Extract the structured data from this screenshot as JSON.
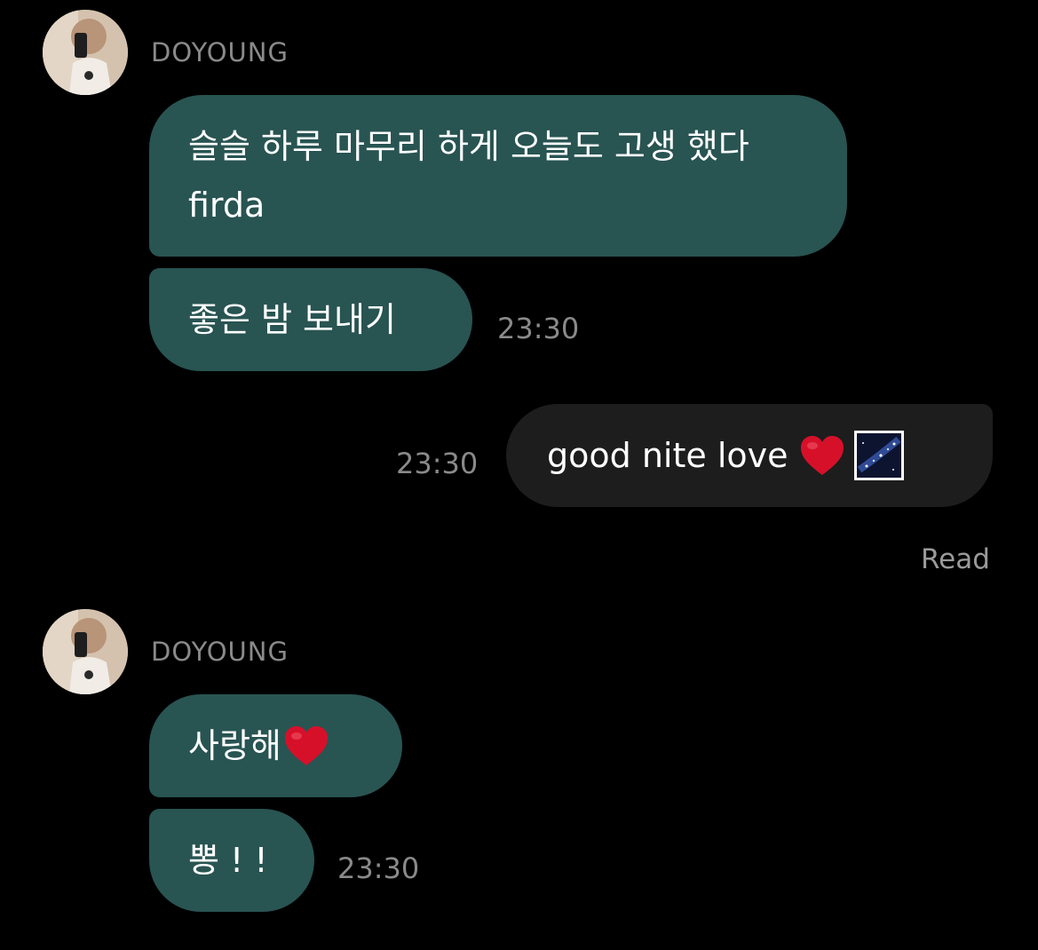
{
  "chat": {
    "groups": [
      {
        "sender": "DOYOUNG",
        "messages": [
          {
            "text": "슬슬 하루 마무리 하게 오늘도 고생 했다 firda"
          },
          {
            "text": "좋은 밤 보내기",
            "time": "23:30"
          }
        ]
      },
      {
        "outgoing": true,
        "messages": [
          {
            "text": "good nite love",
            "time": "23:30",
            "emoji": [
              "red-heart-icon",
              "milky-way-icon"
            ]
          }
        ],
        "status": "Read"
      },
      {
        "sender": "DOYOUNG",
        "messages": [
          {
            "text": "사랑해",
            "emoji": [
              "red-heart-icon"
            ]
          },
          {
            "text": "뽕 ! !",
            "time": "23:30"
          }
        ]
      }
    ]
  },
  "colors": {
    "background": "#000000",
    "incoming_bubble": "#285452",
    "outgoing_bubble": "#1d1d1d",
    "muted_text": "#8a8a8a",
    "heart": "#d7102a"
  }
}
